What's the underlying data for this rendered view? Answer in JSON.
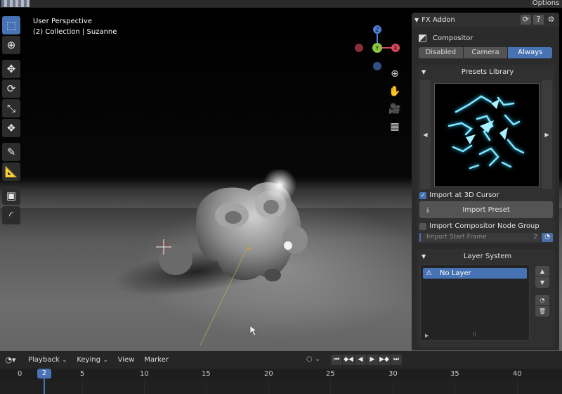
{
  "topbar": {
    "options_label": "Options"
  },
  "viewport": {
    "view_name": "User Perspective",
    "collection_line": "(2) Collection | Suzanne",
    "gizmo": {
      "x_label": "X",
      "y_label": "Y",
      "z_label": "Z"
    },
    "nav_icons": [
      "zoom-icon",
      "hand-pan-icon",
      "camera-icon",
      "grid-ortho-icon"
    ]
  },
  "toolbar": {
    "tools": [
      "select-box-tool",
      "cursor-tool",
      "move-tool",
      "rotate-tool",
      "scale-tool",
      "transform-tool",
      "annotate-tool",
      "measure-tool",
      "add-cube-tool",
      "extra-tool"
    ],
    "active": "select-box-tool"
  },
  "panel": {
    "title": "FX Addon",
    "compositor_label": "Compositor",
    "modes": [
      "Disabled",
      "Camera",
      "Always"
    ],
    "selected_mode": "Always",
    "presets": {
      "title": "Presets Library",
      "import_at_cursor_label": "Import at 3D Cursor",
      "import_at_cursor_checked": true,
      "import_preset_label": "Import Preset",
      "import_node_group_label": "Import Compositor Node Group",
      "import_node_group_checked": false,
      "start_frame_label": "Import Start Frame",
      "start_frame_value": "2"
    },
    "layers": {
      "title": "Layer System",
      "items": [
        {
          "label": "No Layer",
          "warning": true
        }
      ]
    }
  },
  "timeline": {
    "menus": [
      "Playback",
      "Keying",
      "View",
      "Marker"
    ],
    "current_frame": "2",
    "ticks": [
      "0",
      "5",
      "10",
      "15",
      "20",
      "25",
      "30",
      "35",
      "40"
    ]
  },
  "colors": {
    "accent": "#4772b3",
    "x_axis": "#d9475a",
    "y_axis": "#8cc63f",
    "z_axis": "#4f7ed8"
  }
}
